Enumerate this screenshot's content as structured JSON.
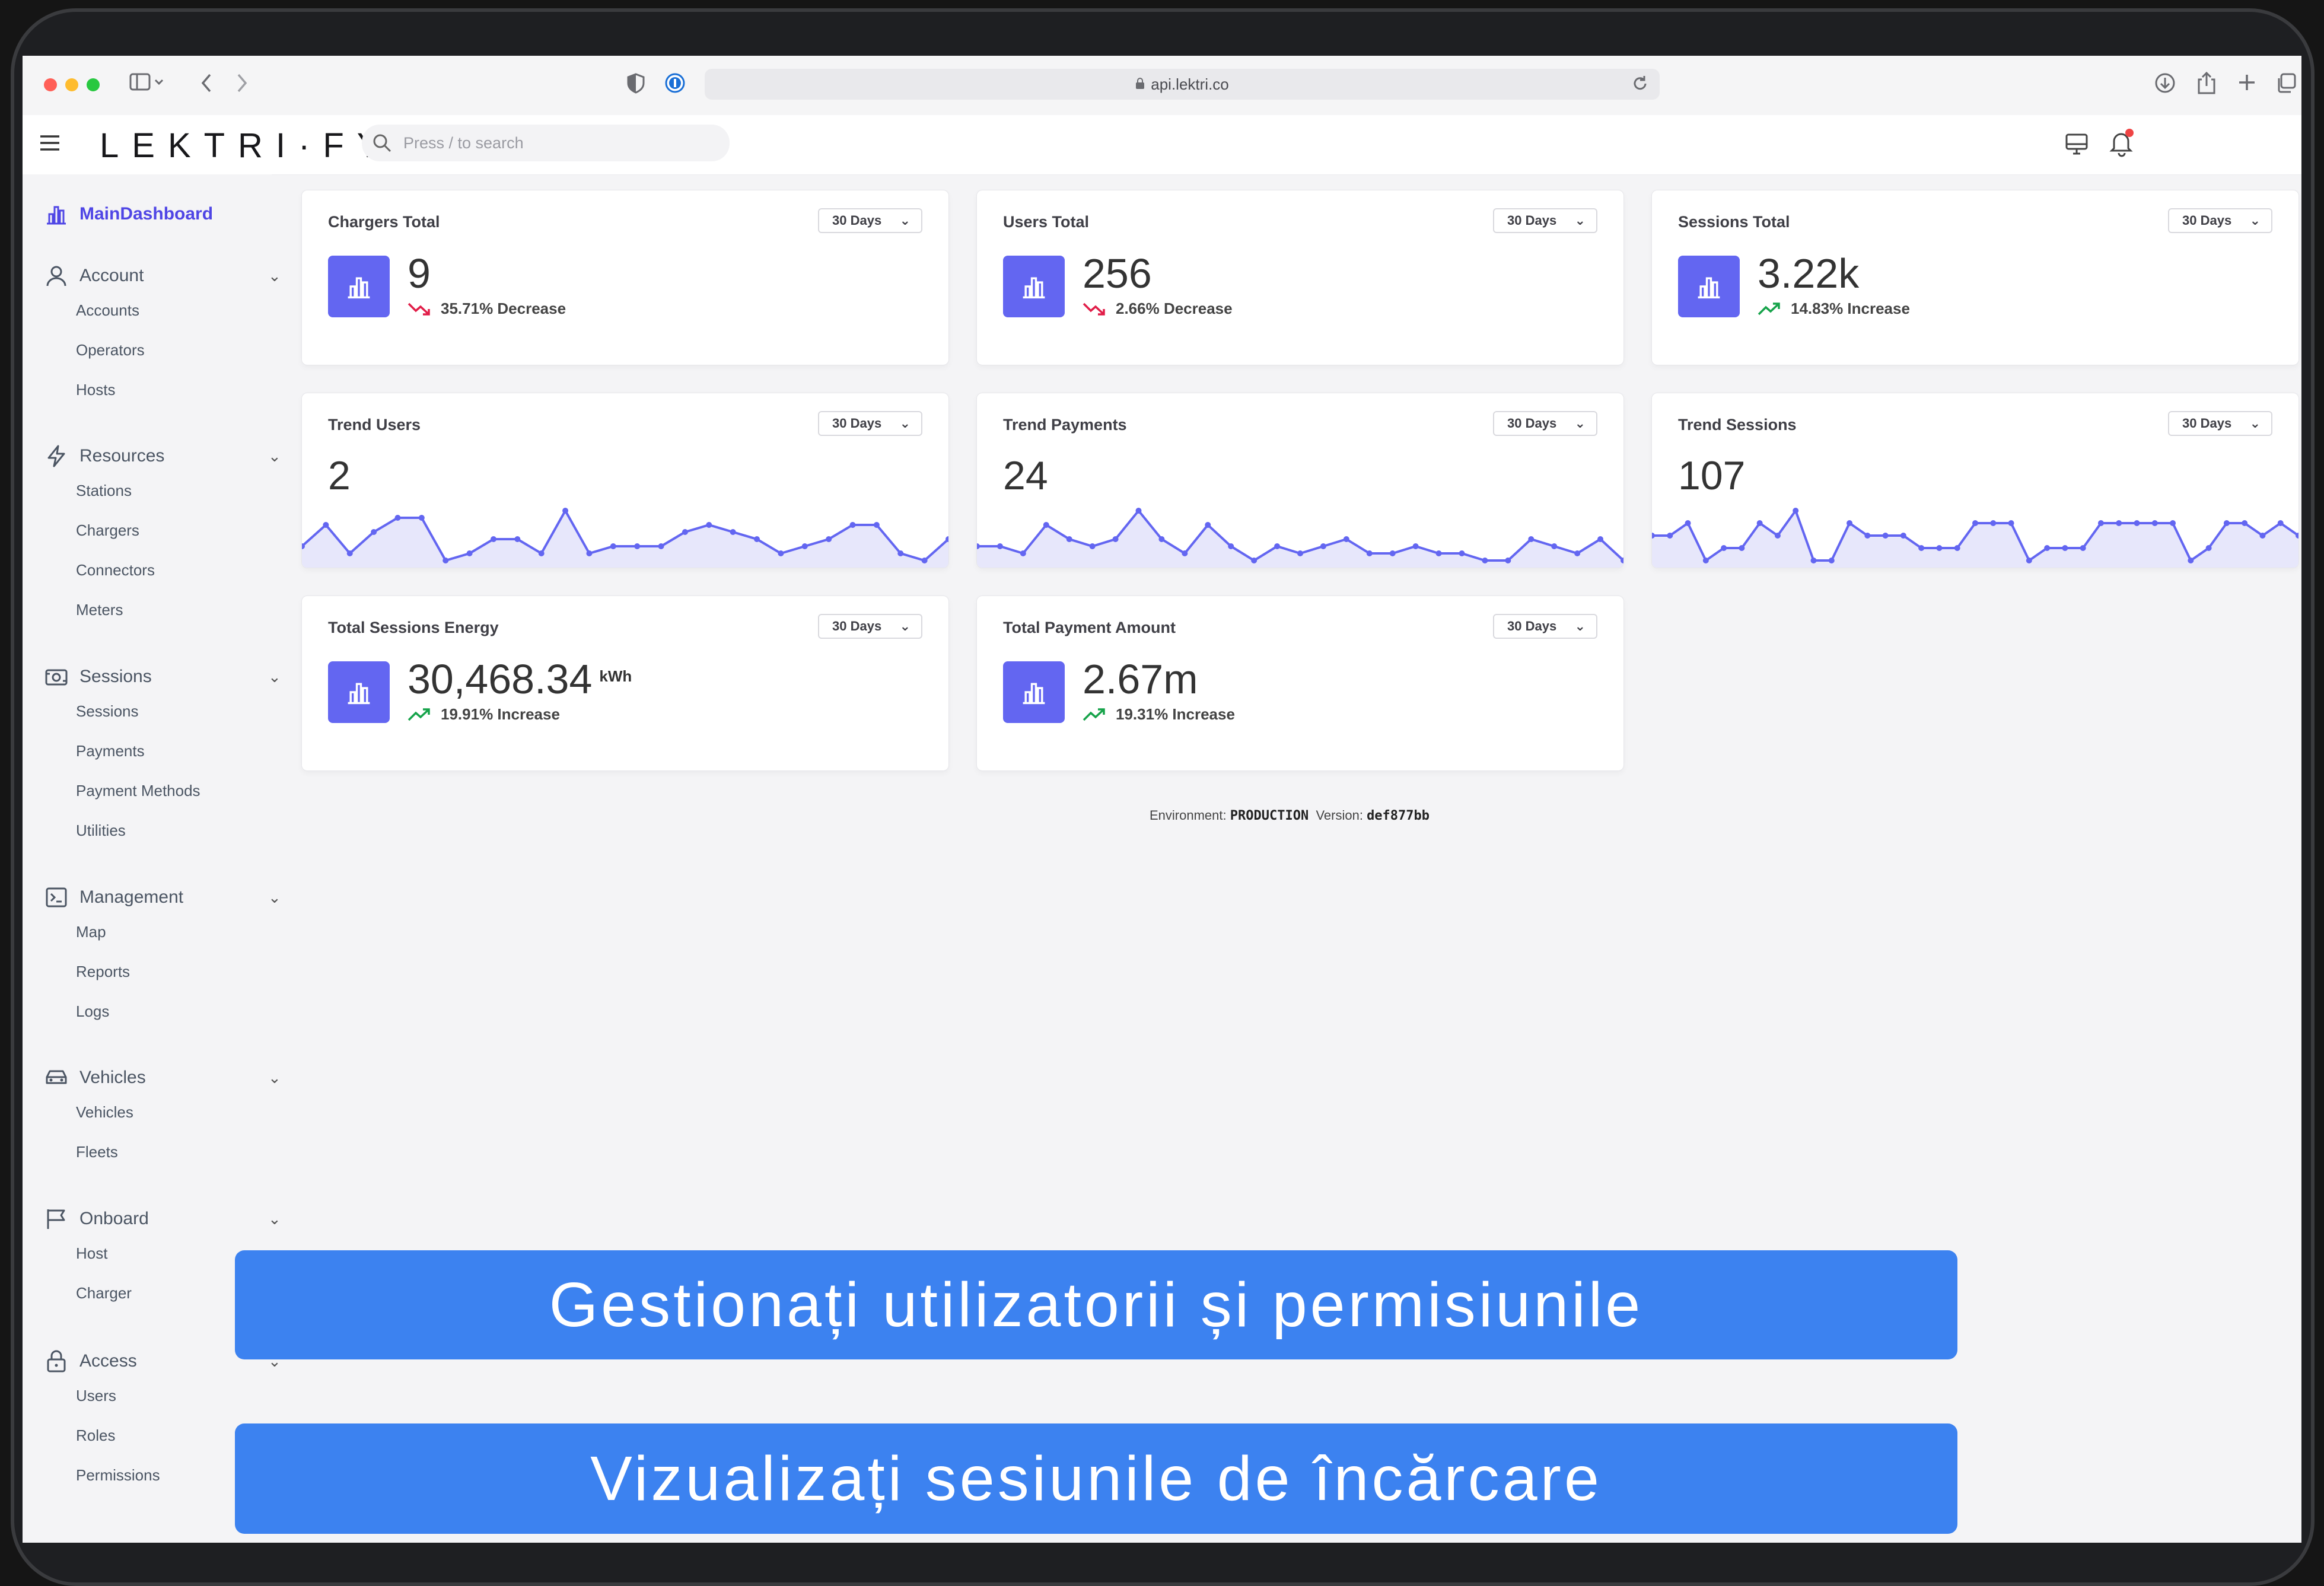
{
  "browser": {
    "url": "api.lektri.co",
    "traffic_lights": [
      "#ff5f57",
      "#febc2e",
      "#28c840"
    ]
  },
  "header": {
    "logo": "LEKTRI·FY",
    "search_placeholder": "Press / to search"
  },
  "sidebar": {
    "main_dashboard": "MainDashboard",
    "groups": [
      {
        "label": "Account",
        "icon": "user-icon",
        "items": [
          "Accounts",
          "Operators",
          "Hosts"
        ]
      },
      {
        "label": "Resources",
        "icon": "bolt-icon",
        "items": [
          "Stations",
          "Chargers",
          "Connectors",
          "Meters"
        ]
      },
      {
        "label": "Sessions",
        "icon": "sessions-icon",
        "items": [
          "Sessions",
          "Payments",
          "Payment Methods",
          "Utilities"
        ]
      },
      {
        "label": "Management",
        "icon": "terminal-icon",
        "items": [
          "Map",
          "Reports",
          "Logs"
        ]
      },
      {
        "label": "Vehicles",
        "icon": "car-icon",
        "items": [
          "Vehicles",
          "Fleets"
        ]
      },
      {
        "label": "Onboard",
        "icon": "flag-icon",
        "items": [
          "Host",
          "Charger"
        ]
      },
      {
        "label": "Access",
        "icon": "lock-icon",
        "items": [
          "Users",
          "Roles",
          "Permissions"
        ]
      }
    ]
  },
  "period": "30 Days",
  "stats": [
    {
      "title": "Chargers Total",
      "value": "9",
      "delta": "35.71% Decrease",
      "trend": "down"
    },
    {
      "title": "Users Total",
      "value": "256",
      "delta": "2.66% Decrease",
      "trend": "down"
    },
    {
      "title": "Sessions Total",
      "value": "3.22k",
      "delta": "14.83% Increase",
      "trend": "up"
    }
  ],
  "trends": [
    {
      "title": "Trend Users",
      "value": "2",
      "series": [
        2,
        5,
        1,
        4,
        6,
        6,
        0,
        1,
        3,
        3,
        1,
        7,
        1,
        2,
        2,
        2,
        4,
        5,
        4,
        3,
        1,
        2,
        3,
        5,
        5,
        1,
        0,
        3
      ]
    },
    {
      "title": "Trend Payments",
      "value": "24",
      "series": [
        2,
        2,
        1,
        5,
        3,
        2,
        3,
        7,
        3,
        1,
        5,
        2,
        0,
        2,
        1,
        2,
        3,
        1,
        1,
        2,
        1,
        1,
        0,
        0,
        3,
        2,
        1,
        3,
        0
      ]
    },
    {
      "title": "Trend Sessions",
      "value": "107",
      "series": [
        3,
        3,
        4,
        1,
        2,
        2,
        4,
        3,
        5,
        1,
        1,
        4,
        3,
        3,
        3,
        2,
        2,
        2,
        4,
        4,
        4,
        1,
        2,
        2,
        2,
        4,
        4,
        4,
        4,
        4,
        1,
        2,
        4,
        4,
        3,
        4,
        3
      ]
    }
  ],
  "energy": [
    {
      "title": "Total Sessions Energy",
      "value": "30,468.34",
      "unit": "kWh",
      "delta": "19.91% Increase",
      "trend": "up"
    },
    {
      "title": "Total Payment Amount",
      "value": "2.67m",
      "unit": "",
      "delta": "19.31% Increase",
      "trend": "up"
    }
  ],
  "footer": {
    "env_label": "Environment:",
    "env_value": "PRODUCTION",
    "version_label": "Version:",
    "version_value": "def877bb"
  },
  "banners": [
    "Gestionați utilizatorii și permisiunile",
    "Vizualizați sesiunile de încărcare"
  ],
  "colors": {
    "accent": "#6366f1",
    "decrease": "#e11d48",
    "increase": "#16a34a",
    "banner": "#3c82f0"
  }
}
